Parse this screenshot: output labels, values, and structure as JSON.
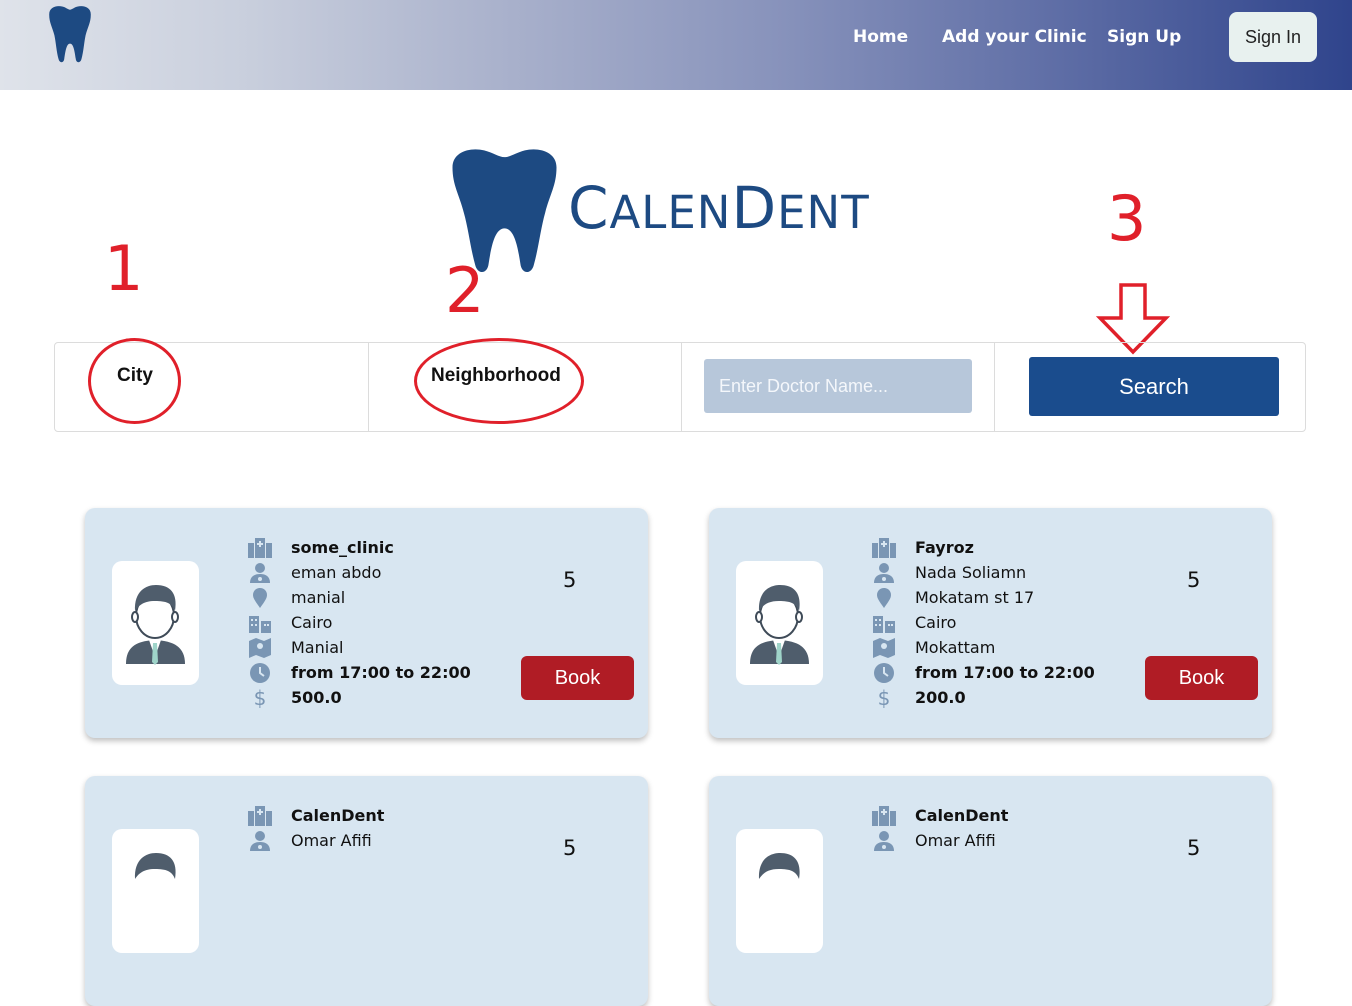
{
  "nav": {
    "links": [
      "Home",
      "Add your Clinic",
      "Sign Up"
    ],
    "signin_label": "Sign In",
    "logo_icon": "tooth-icon"
  },
  "brand": {
    "first_big": "C",
    "first_small": "ALEN",
    "second_big": "D",
    "second_small": "ENT"
  },
  "annotations": {
    "one": "1",
    "two": "2",
    "three": "3"
  },
  "search": {
    "city_label": "City",
    "neighborhood_label": "Neighborhood",
    "doctor_placeholder": "Enter Doctor Name...",
    "button_label": "Search"
  },
  "cards": [
    {
      "clinic": "some_clinic",
      "doctor": "eman abdo",
      "address": "manial",
      "city": "Cairo",
      "neighborhood": "Manial",
      "hours": "from 17:00 to 22:00",
      "price": "500.0",
      "rating": "5",
      "book_label": "Book"
    },
    {
      "clinic": "Fayroz",
      "doctor": "Nada Soliamn",
      "address": "Mokatam st 17",
      "city": "Cairo",
      "neighborhood": "Mokattam",
      "hours": "from 17:00 to 22:00",
      "price": "200.0",
      "rating": "5",
      "book_label": "Book"
    },
    {
      "clinic": "CalenDent",
      "doctor": "Omar Afifi",
      "rating": "5"
    },
    {
      "clinic": "CalenDent",
      "doctor": "Omar Afifi",
      "rating": "5"
    }
  ],
  "colors": {
    "brand_blue": "#1d4a82",
    "book_red": "#b01c25",
    "annotation_red": "#e0202a",
    "card_bg": "#d8e6f1"
  }
}
